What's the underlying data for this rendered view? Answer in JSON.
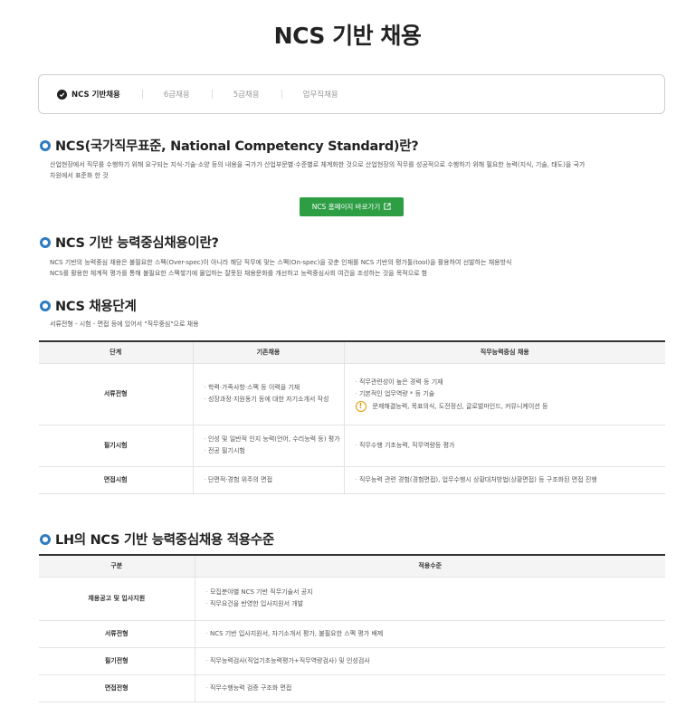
{
  "page": {
    "title": "NCS 기반 채용"
  },
  "tabs": [
    {
      "label": "NCS 기반채용",
      "active": true
    },
    {
      "label": "6급채용",
      "active": false
    },
    {
      "label": "5급채용",
      "active": false
    },
    {
      "label": "업무직채용",
      "active": false
    }
  ],
  "section1": {
    "title": "NCS(국가직무표준, National Competency Standard)란?",
    "desc_line1": "산업현장에서 직무를 수행하기 위해 요구되는 지식·기술·소양 등의 내용을 국가가 산업부문별·수준별로 체계화한 것으로 산업현장의 직무를 성공적으로 수행하기 위해 필요한 능력(지식, 기술, 태도)을 국가",
    "desc_line2": "차원에서 표준화 한 것",
    "button_label": "NCS 홈페이지 바로가기",
    "button_icon": "external-link-icon"
  },
  "section2": {
    "title": "NCS 기반 능력중심채용이란?",
    "desc_line1": "NCS 기반의 능력중심 채용은 불필요한 스펙(Over-spec)이 아니라 해당 직무에 맞는 스펙(On-spec)을 갖춘 인재를 NCS 기반의 평가툴(tool)을 활용하여 선발하는 채용방식",
    "desc_line2": "NCS를 활용한 체계적 평가를 통해 불필요한 스펙쌓기에 몰입하는 잘못된 채용문화를 개선하고 능력중심사회 여건을 조성하는 것을 목적으로 함"
  },
  "section3": {
    "title": "NCS 채용단계",
    "desc": "서류전형 - 시험 - 면접 등에 있어서 \"직무중심\"으로 채용",
    "headers": [
      "단계",
      "기존채용",
      "직무능력중심 채용"
    ],
    "rows": [
      {
        "stage": "서류전형",
        "old": [
          "학력·가족사항·스펙 등 이력을 기재",
          "성장과정·지원동기 등에 대한 자기소개서 작성"
        ],
        "new": [
          "직무관련성이 높은 경력 등 기재",
          "기본적인 업무역량 * 등 기술"
        ],
        "note": "문제해결능력, 목표의식, 도전정신, 글로벌마인드, 커뮤니케이션 등"
      },
      {
        "stage": "필기시험",
        "old": [
          "인성 및 일반적 인지 능력(언어, 수리능력 등) 평가",
          "전공 필기시험"
        ],
        "new": [
          "직무수행 기초능력, 직무역량등 평가"
        ]
      },
      {
        "stage": "면접시험",
        "old": [
          "단편적·경험 위주의 면접"
        ],
        "new": [
          "직무능력 관련 경험(경험면접), 업무수행시 상황대처방법(상황면접) 등 구조화된 면접 진행"
        ]
      }
    ]
  },
  "section4": {
    "title": "LH의 NCS 기반 능력중심채용 적용수준",
    "headers": [
      "구분",
      "적용수준"
    ],
    "rows": [
      {
        "stage": "채용공고 및 입사지원",
        "items": [
          "모집분야별 NCS 기반 직무기술서 공지",
          "직무요건을 반영한 입사지원서 개발"
        ]
      },
      {
        "stage": "서류전형",
        "items": [
          "NCS 기반 입사지원서, 자기소개서 평가, 불필요한 스펙 평가 배제"
        ]
      },
      {
        "stage": "필기전형",
        "items": [
          "직무능력검사(직업기초능력평가+직무역량검사) 및 인성검사"
        ]
      },
      {
        "stage": "면접전형",
        "items": [
          "직무수행능력 검증 구조화 면접"
        ]
      }
    ]
  },
  "colors": {
    "accent_green": "#2e9e45",
    "bullet_blue": "#2f7cc1",
    "warn_orange": "#e59a00"
  }
}
